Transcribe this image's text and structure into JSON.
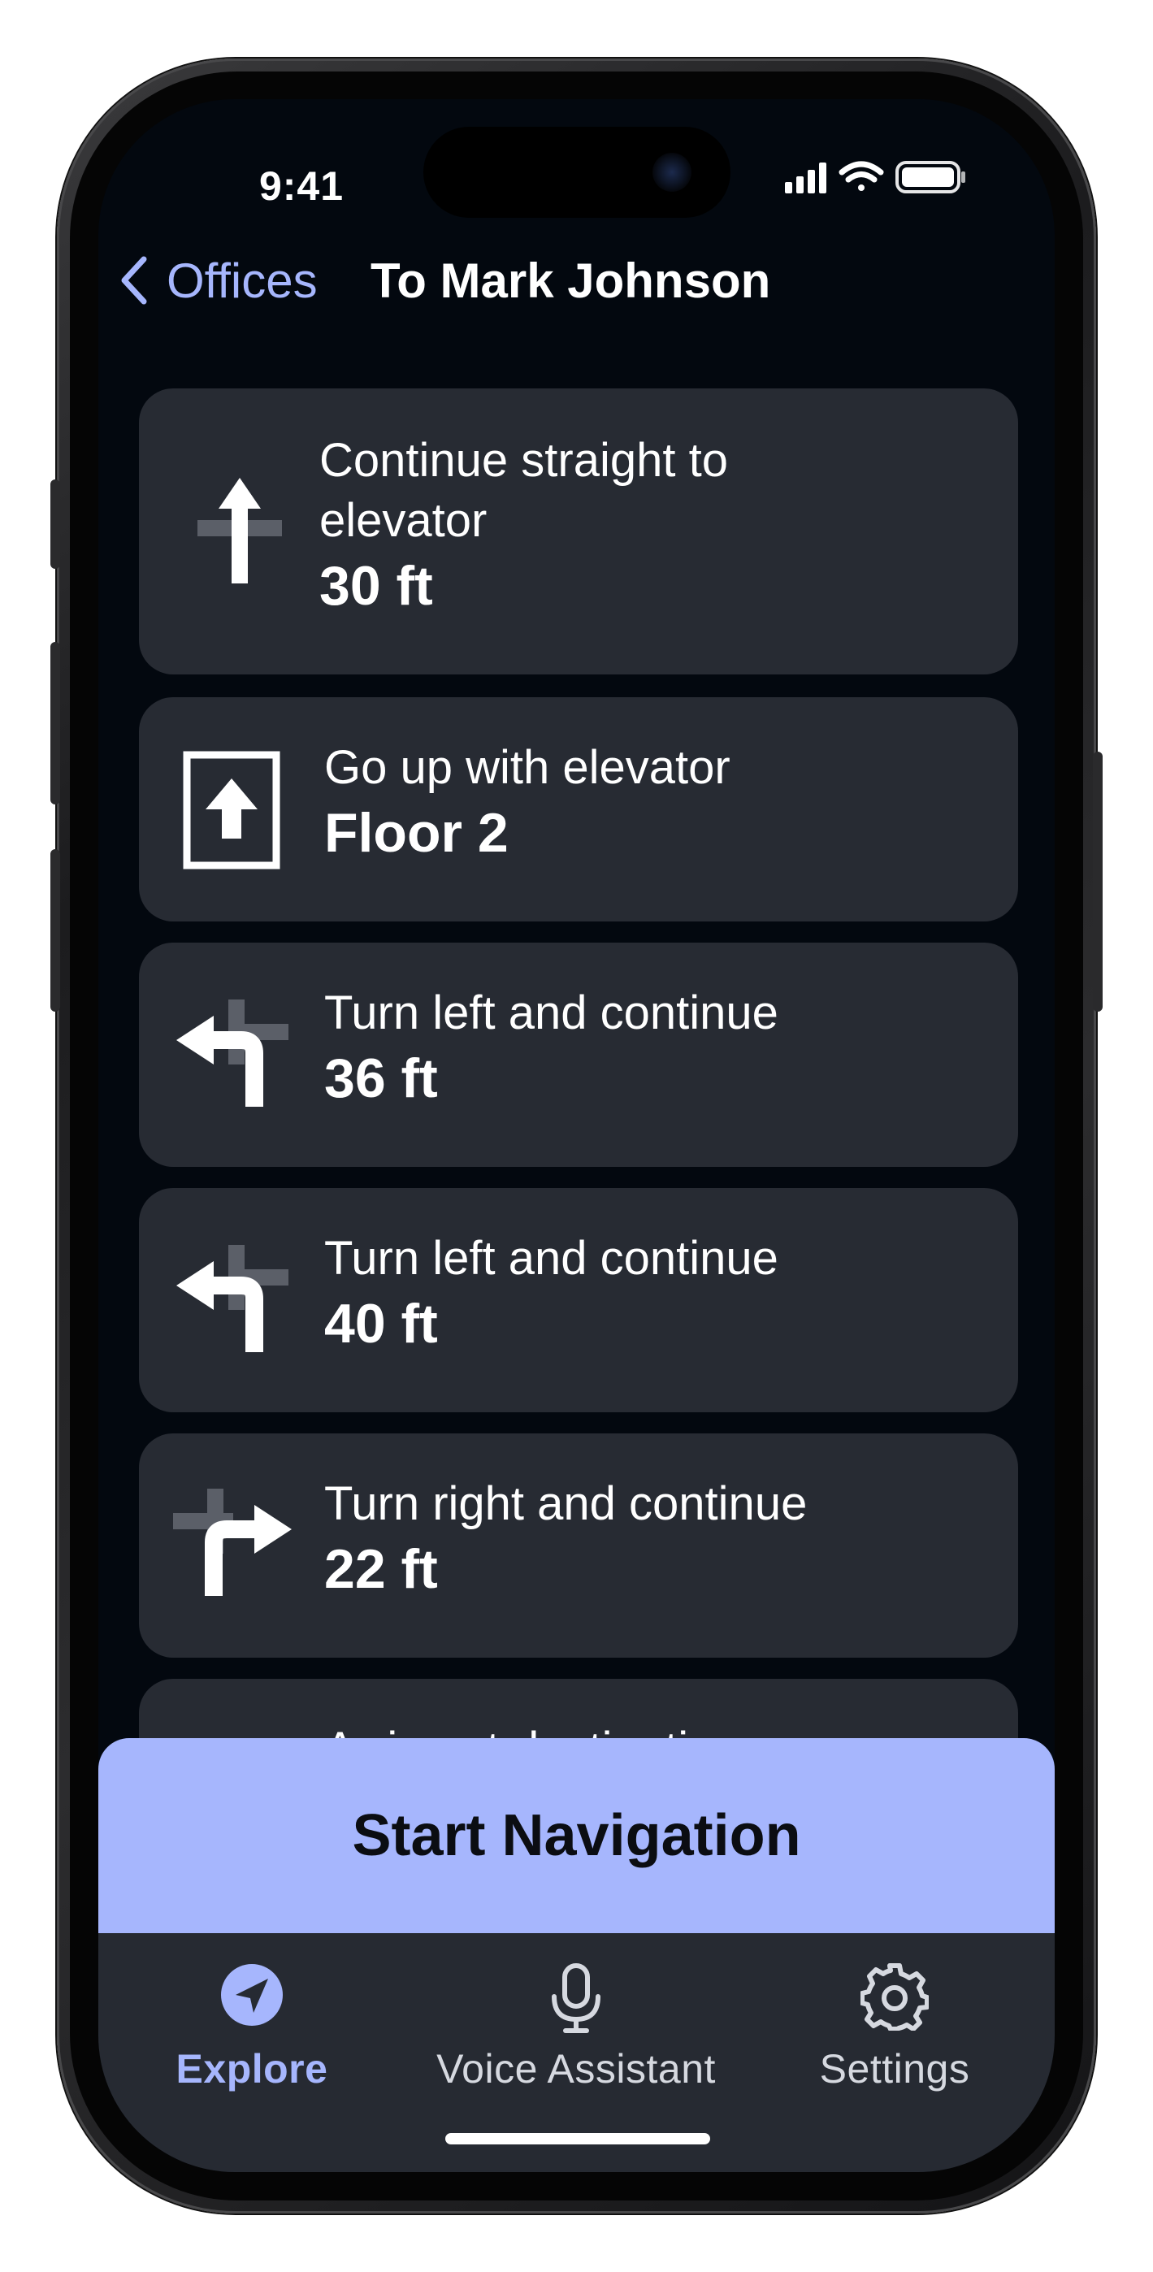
{
  "status_bar": {
    "time": "9:41"
  },
  "nav": {
    "back_label": "Offices",
    "title": "To Mark Johnson"
  },
  "steps": [
    {
      "instruction_line1": "Continue straight to",
      "instruction_line2": "elevator",
      "distance": "30 ft",
      "icon": "straight-arrow-icon"
    },
    {
      "instruction": "Go up with elevator",
      "distance": "Floor 2",
      "icon": "elevator-up-icon"
    },
    {
      "instruction": "Turn left and continue",
      "distance": "36 ft",
      "icon": "turn-left-icon"
    },
    {
      "instruction": "Turn left and continue",
      "distance": "40 ft",
      "icon": "turn-left-icon"
    },
    {
      "instruction": "Turn right and continue",
      "distance": "22 ft",
      "icon": "turn-right-icon"
    },
    {
      "instruction": "Arrive at destination",
      "icon": "destination-icon"
    }
  ],
  "primary_action": {
    "label": "Start Navigation"
  },
  "tabbar": {
    "tabs": [
      {
        "label": "Explore",
        "icon": "navigation-arrow-icon",
        "active": true
      },
      {
        "label": "Voice Assistant",
        "icon": "microphone-icon",
        "active": false
      },
      {
        "label": "Settings",
        "icon": "gear-icon",
        "active": false
      }
    ]
  },
  "colors": {
    "accent": "#a6b6fd",
    "background": "#03080f",
    "card": "#272b33",
    "tabbar": "#262a32"
  }
}
